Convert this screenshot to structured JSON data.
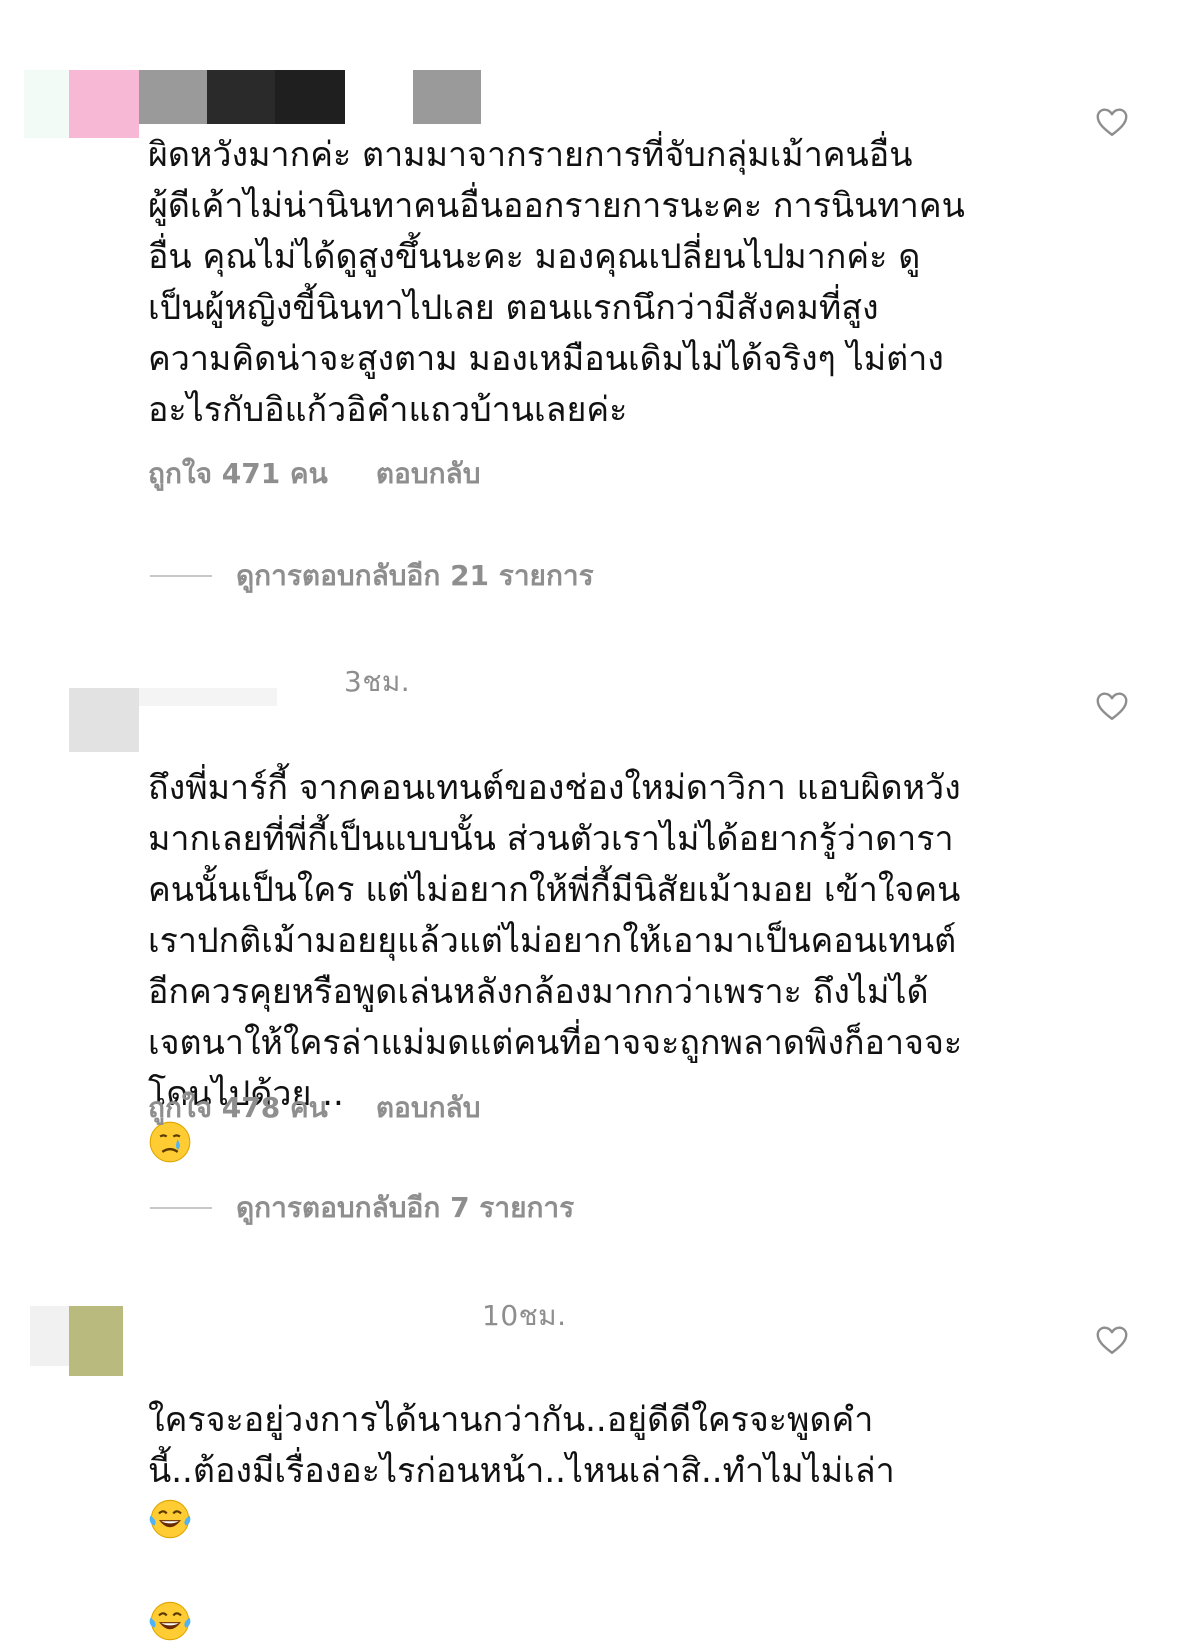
{
  "comments": [
    {
      "timestamp": "",
      "text": "ผิดหวังมากค่ะ ตามมาจากรายการที่จับกลุ่มเม้าคนอื่น\nผู้ดีเค้าไม่น่านินทาคนอื่นออกรายการนะคะ การนินทาคน\nอื่น คุณไม่ได้ดูสูงขึ้นนะคะ มองคุณเปลี่ยนไปมากค่ะ ดู\nเป็นผู้หญิงขี้นินทาไปเลย ตอนแรกนึกว่ามีสังคมที่สูง\nความคิดน่าจะสูงตาม มองเหมือนเดิมไม่ได้จริงๆ ไม่ต่าง\nอะไรกับอิแก้วอิคำแถวบ้านเลยค่ะ",
      "likes": "ถูกใจ 471 คน",
      "reply": "ตอบกลับ",
      "view_replies": "ดูการตอบกลับอีก 21 รายการ"
    },
    {
      "timestamp": "3ชม.",
      "text": "ถึงพี่มาร์กี้ จากคอนเทนต์ของช่องใหม่ดาวิกา แอบผิดหวัง\nมากเลยที่พี่กี้เป็นแบบนั้น ส่วนตัวเราไม่ได้อยากรู้ว่าดารา\nคนนั้นเป็นใคร แต่ไม่อยากให้พี่กี้มีนิสัยเม้ามอย เข้าใจคน\nเราปกติเม้ามอยยุแล้วแต่ไม่อยากให้เอามาเป็นคอนเทนต์\nอีกควรคุยหรือพูดเล่นหลังกล้องมากกว่าเพราะ ถึงไม่ได้\nเจตนาให้ใครล่าแม่มดแต่คนที่อาจจะถูกพลาดพิงก็อาจจะ\nโดนไปด้วย ..",
      "likes": "ถูกใจ 478 คน",
      "reply": "ตอบกลับ",
      "view_replies": "ดูการตอบกลับอีก 7 รายการ"
    },
    {
      "timestamp": "10ชม.",
      "text": "ใครจะอยู่วงการได้นานกว่ากัน..อยู่ดีดีใครจะพูดคำ\nนี้..ต้องมีเรื่องอะไรก่อนหน้า..ไหนเล่าสิ..ทำไมไม่เล่า"
    }
  ],
  "icons": {
    "like": "heart-outline-icon",
    "crying_emoji": "crying-face-emoji",
    "laughing_emoji": "tears-of-joy-emoji"
  },
  "colors": {
    "text": "#111111",
    "meta": "#8e8e8e",
    "divider": "#c7c7c7",
    "censor_pink": "#f7b8d6",
    "censor_gray": "#9a9a9a",
    "censor_dark": "#242424",
    "censor_olive": "#b9bb7e"
  }
}
